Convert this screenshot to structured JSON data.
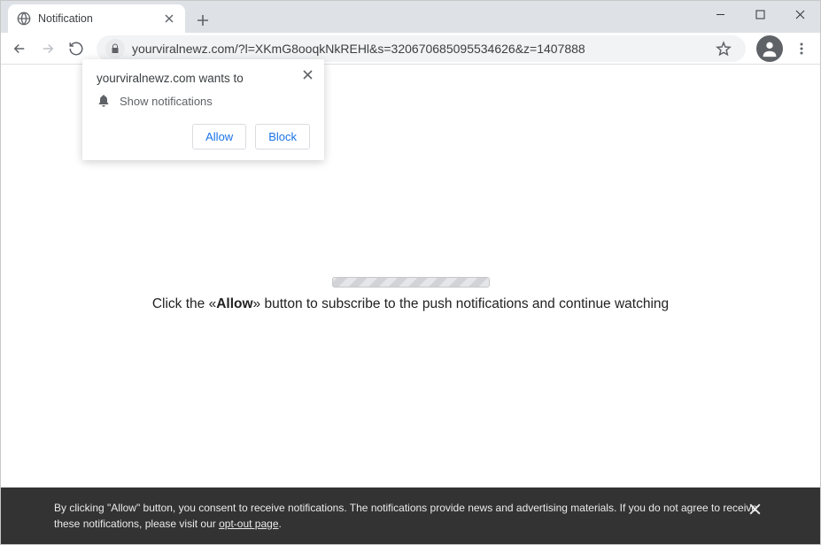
{
  "tab": {
    "title": "Notification"
  },
  "omnibox": {
    "url": "yourviralnewz.com/?l=XKmG8ooqkNkREHl&s=320670685095534626&z=1407888"
  },
  "permission_prompt": {
    "wants_text": "yourviralnewz.com wants to",
    "capability_label": "Show notifications",
    "allow_label": "Allow",
    "block_label": "Block"
  },
  "page_content": {
    "message_prefix": "Click the «",
    "message_bold": "Allow",
    "message_suffix": "» button to subscribe to the push notifications and continue watching"
  },
  "footer": {
    "text_part1": "By clicking \"Allow\" button, you consent to receive notifications. The notifications provide news and advertising materials. If you do not agree to receive these notifications, please visit our ",
    "link_text": "opt-out page",
    "text_part2": "."
  }
}
